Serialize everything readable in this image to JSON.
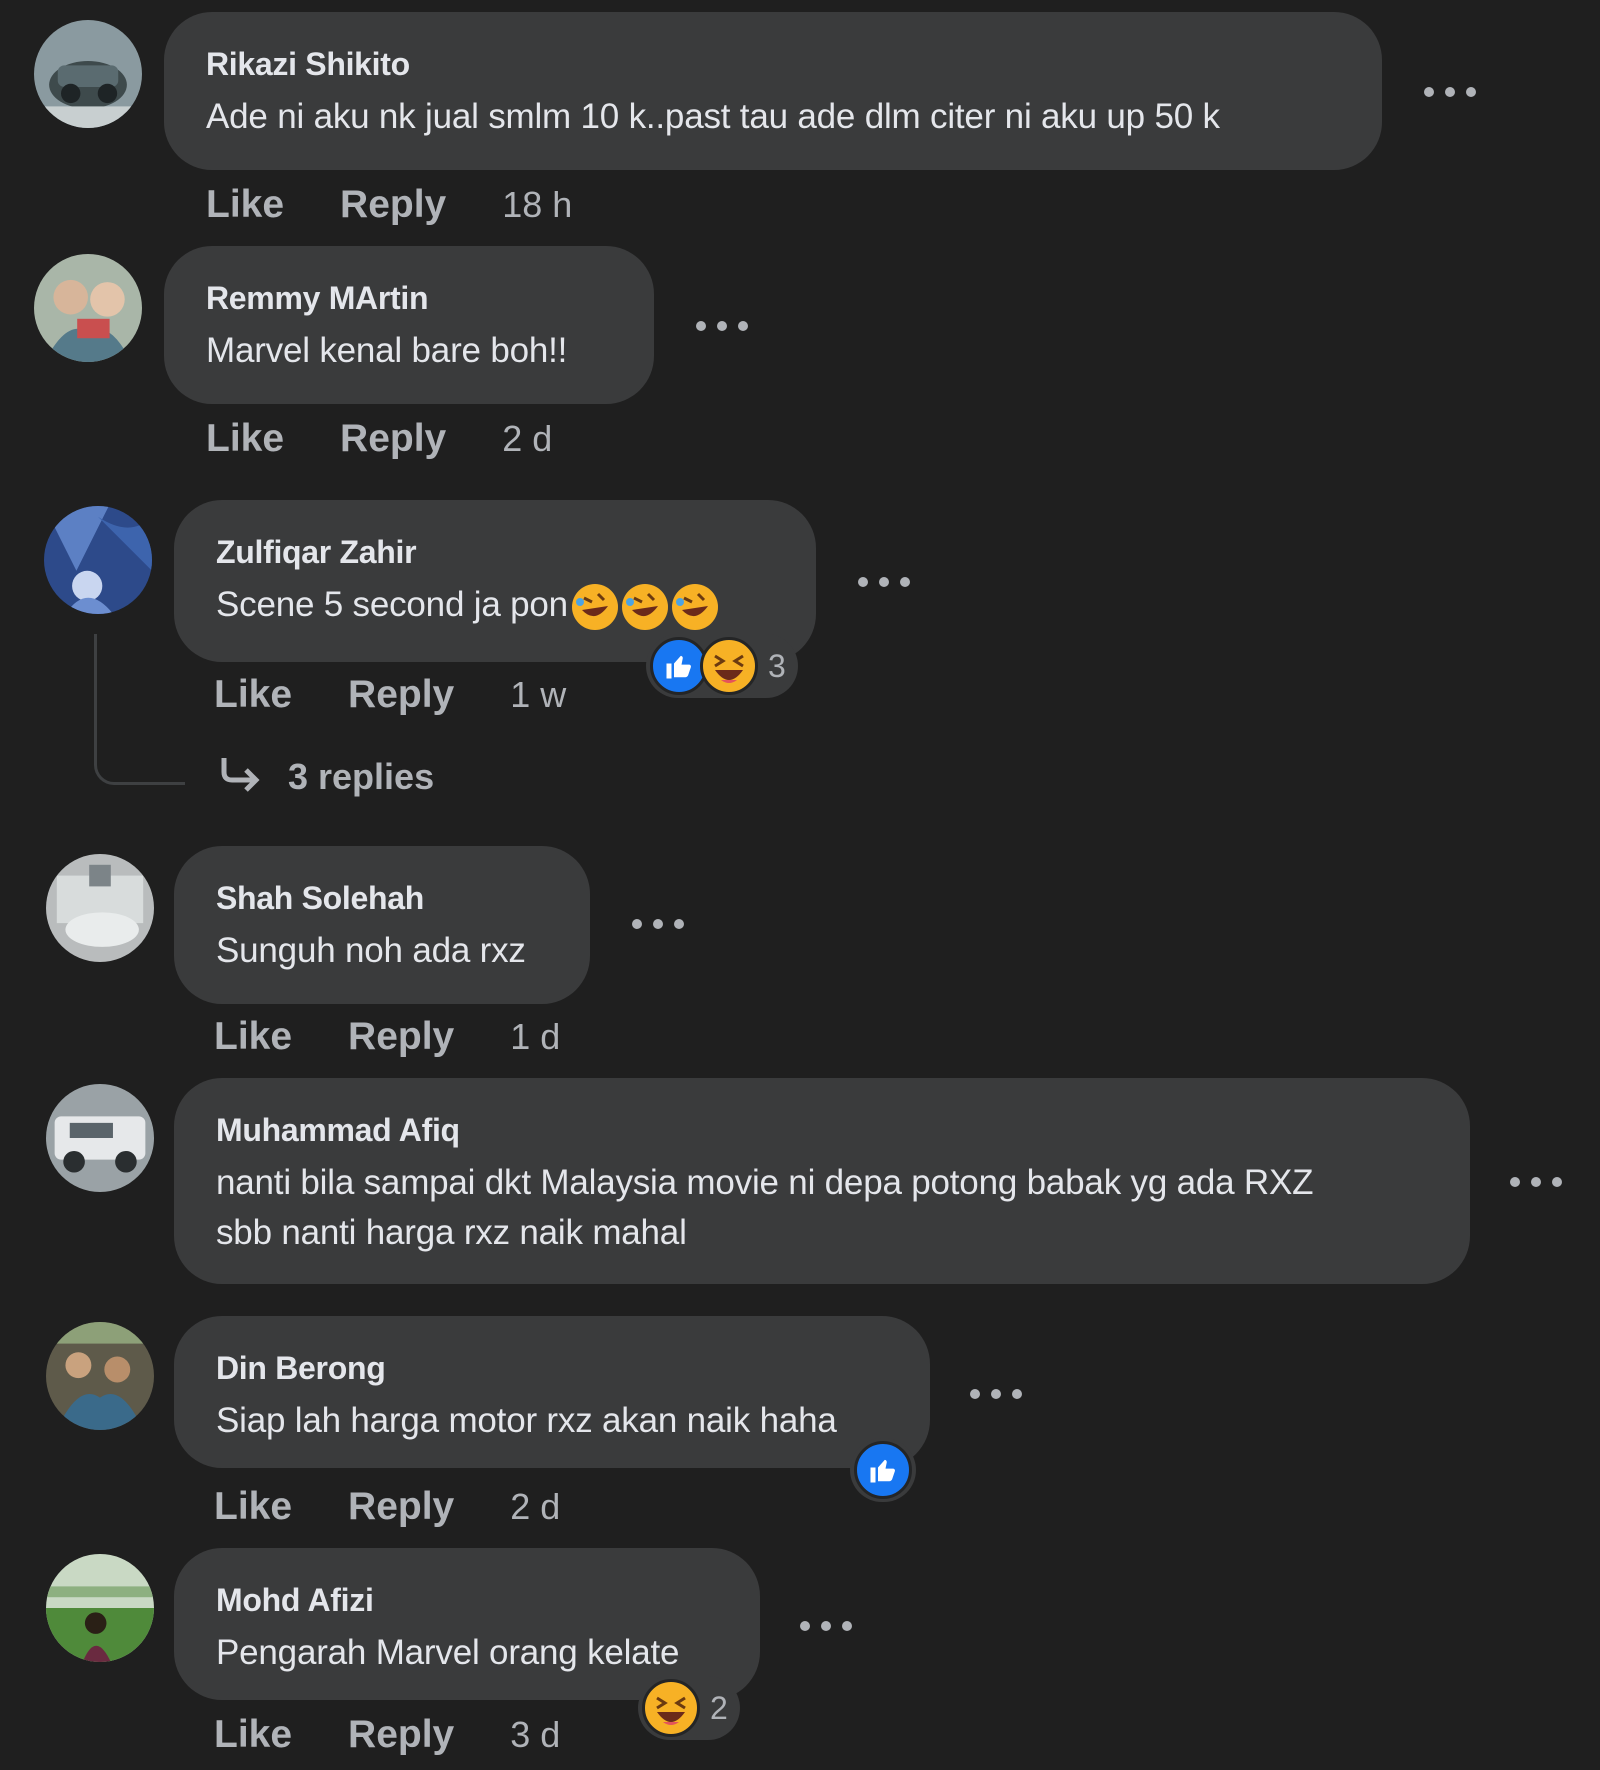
{
  "actions": {
    "like": "Like",
    "reply": "Reply"
  },
  "comments": [
    {
      "author": "Rikazi Shikito",
      "text": "Ade ni aku nk jual smlm 10 k..past tau ade dlm citer ni aku up 50 k",
      "time": "18 h"
    },
    {
      "author": "Remmy MArtin",
      "text": "Marvel kenal bare boh!!",
      "time": "2 d"
    },
    {
      "author": "Zulfiqar Zahir",
      "text": "Scene 5 second ja pon",
      "time": "1 w",
      "text_emojis": [
        "rolling-on-floor-laughing",
        "rolling-on-floor-laughing",
        "rolling-on-floor-laughing"
      ],
      "reactions": [
        "like",
        "haha"
      ],
      "reaction_count": "3",
      "replies_label": "3 replies"
    },
    {
      "author": "Shah Solehah",
      "text": "Sunguh noh ada rxz",
      "time": "1 d"
    },
    {
      "author": "Muhammad Afiq",
      "text_line1": "nanti bila sampai dkt Malaysia movie ni depa potong babak yg ada RXZ",
      "text_line2": "sbb nanti harga rxz naik mahal",
      "time": ""
    },
    {
      "author": "Din Berong",
      "text": "Siap lah harga motor rxz akan naik haha",
      "time": "2 d",
      "reactions": [
        "like"
      ]
    },
    {
      "author": "Mohd Afizi",
      "text": "Pengarah Marvel orang kelate",
      "time": "3 d",
      "reactions": [
        "haha"
      ],
      "reaction_count": "2"
    }
  ],
  "colors": {
    "background": "#1f1f1f",
    "bubble": "#3a3b3c",
    "text": "#e4e6eb",
    "muted": "#b0b3b8",
    "like_blue": "#1877f2",
    "haha_yellow": "#f7b125"
  }
}
